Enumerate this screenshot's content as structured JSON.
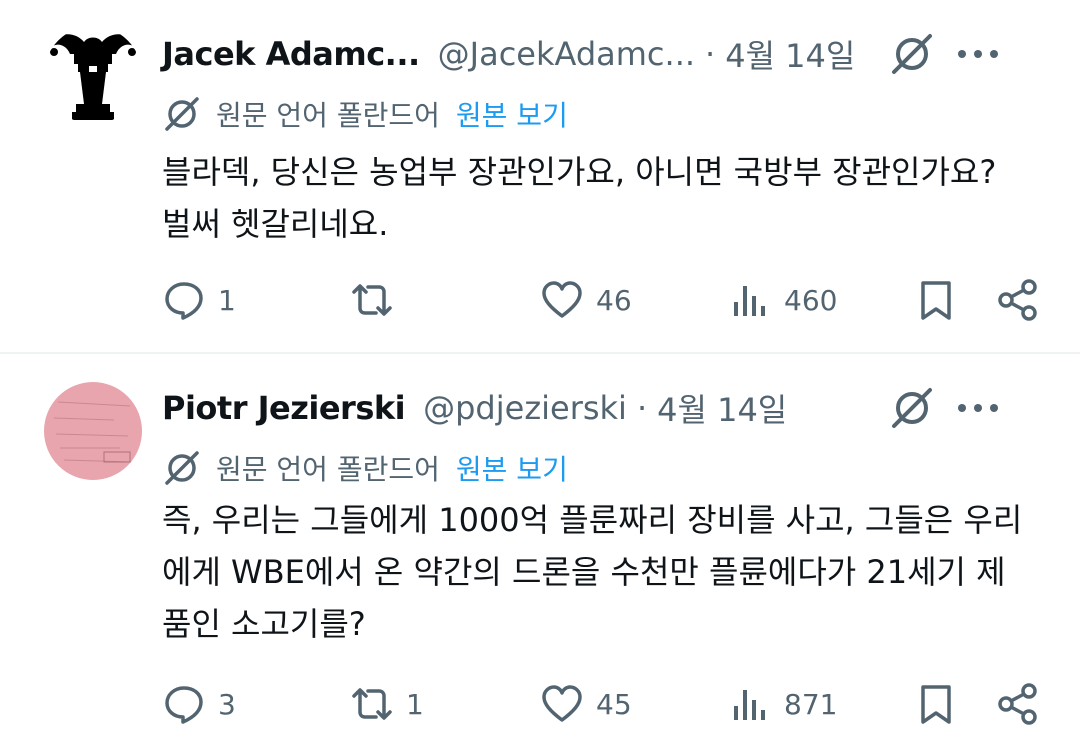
{
  "tweets": [
    {
      "name": "Jacek Adamc...",
      "handle": "@JacekAdamc...",
      "date": "4월 14일",
      "translation_note": "원문 언어 폴란드어",
      "show_original": "원본 보기",
      "text": "블라덱, 당신은 농업부 장관인가요, 아니면 국방부 장관인가요? 벌써 헷갈리네요.",
      "replies": "1",
      "retweets": "",
      "likes": "46",
      "views": "460"
    },
    {
      "name": "Piotr Jezierski",
      "handle": "@pdjezierski",
      "date": "4월 14일",
      "translation_note": "원문 언어 폴란드어",
      "show_original": "원본 보기",
      "text": "즉, 우리는 그들에게 1000억 플룬짜리 장비를 사고, 그들은 우리에게 WBE에서 온 약간의 드론을 수천만 플륜에다가 21세기 제품인 소고기를?",
      "replies": "3",
      "retweets": "1",
      "likes": "45",
      "views": "871"
    }
  ],
  "colors": {
    "text": "#0f1419",
    "secondary": "#536471",
    "link": "#1d9bf0",
    "divider": "#eff3f4",
    "avatar2": "#e8a5ad"
  },
  "icons": [
    "chat-bubble-icon",
    "retweet-icon",
    "heart-icon",
    "views-icon",
    "bookmark-icon",
    "share-icon",
    "grok-icon",
    "more-icon",
    "translate-icon"
  ]
}
